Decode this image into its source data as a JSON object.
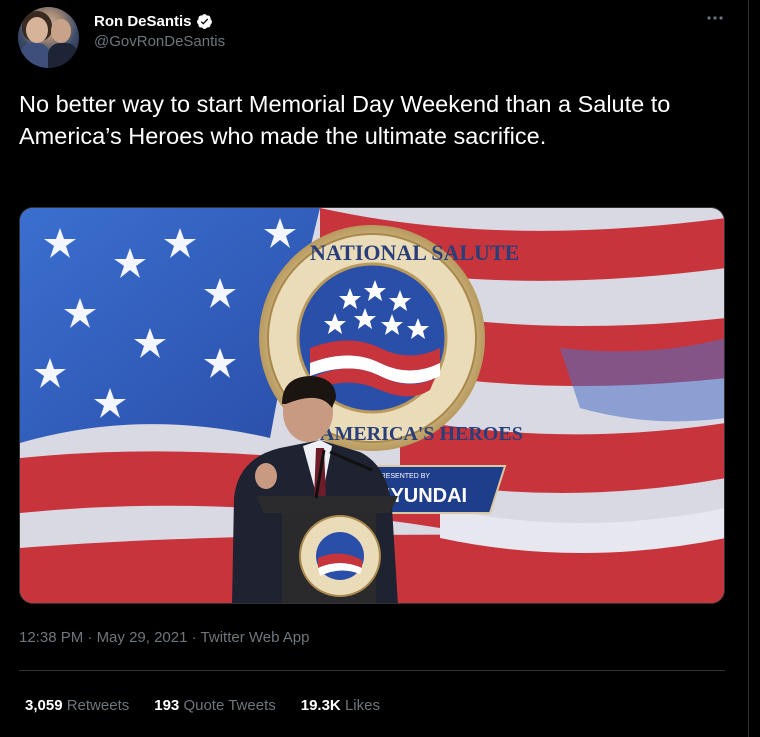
{
  "author": {
    "display_name": "Ron DeSantis",
    "handle": "@GovRonDeSantis"
  },
  "tweet": {
    "text": "No better way to start Memorial Day Weekend than a Salute to America’s Heroes who made the ultimate sacrifice.",
    "time": "12:38 PM",
    "separator": "·",
    "date": "May 29, 2021",
    "source": "Twitter Web App"
  },
  "media": {
    "seal_top_text": "NATIONAL SALUTE",
    "seal_bottom_text": "AMERICA'S HEROES",
    "sponsor_prefix": "PRESENTED BY",
    "sponsor_text": "HYUNDAI"
  },
  "stats": {
    "retweets_count": "3,059",
    "retweets_label": "Retweets",
    "quotes_count": "193",
    "quotes_label": "Quote Tweets",
    "likes_count": "19.3K",
    "likes_label": "Likes"
  },
  "colors": {
    "background": "#000000",
    "text": "#ffffff",
    "muted": "#6e767d",
    "verified": "#ffffff"
  },
  "icons": {
    "verified": "verified-badge-icon",
    "more": "more-horizontal-icon"
  }
}
